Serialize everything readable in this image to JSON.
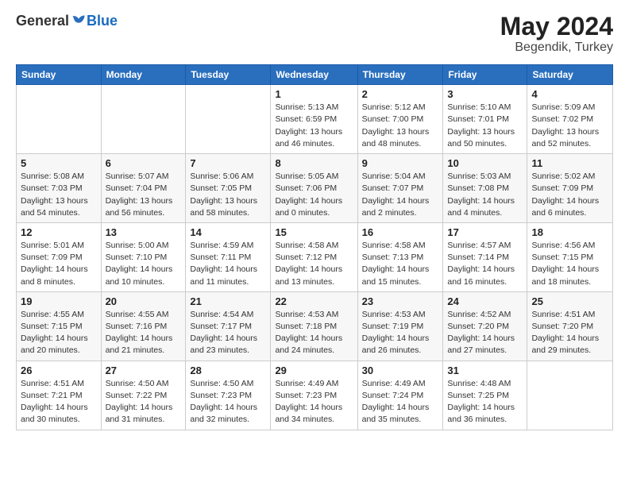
{
  "logo": {
    "general": "General",
    "blue": "Blue"
  },
  "header": {
    "month": "May 2024",
    "location": "Begendik, Turkey"
  },
  "weekdays": [
    "Sunday",
    "Monday",
    "Tuesday",
    "Wednesday",
    "Thursday",
    "Friday",
    "Saturday"
  ],
  "weeks": [
    [
      {
        "day": "",
        "info": ""
      },
      {
        "day": "",
        "info": ""
      },
      {
        "day": "",
        "info": ""
      },
      {
        "day": "1",
        "info": "Sunrise: 5:13 AM\nSunset: 6:59 PM\nDaylight: 13 hours\nand 46 minutes."
      },
      {
        "day": "2",
        "info": "Sunrise: 5:12 AM\nSunset: 7:00 PM\nDaylight: 13 hours\nand 48 minutes."
      },
      {
        "day": "3",
        "info": "Sunrise: 5:10 AM\nSunset: 7:01 PM\nDaylight: 13 hours\nand 50 minutes."
      },
      {
        "day": "4",
        "info": "Sunrise: 5:09 AM\nSunset: 7:02 PM\nDaylight: 13 hours\nand 52 minutes."
      }
    ],
    [
      {
        "day": "5",
        "info": "Sunrise: 5:08 AM\nSunset: 7:03 PM\nDaylight: 13 hours\nand 54 minutes."
      },
      {
        "day": "6",
        "info": "Sunrise: 5:07 AM\nSunset: 7:04 PM\nDaylight: 13 hours\nand 56 minutes."
      },
      {
        "day": "7",
        "info": "Sunrise: 5:06 AM\nSunset: 7:05 PM\nDaylight: 13 hours\nand 58 minutes."
      },
      {
        "day": "8",
        "info": "Sunrise: 5:05 AM\nSunset: 7:06 PM\nDaylight: 14 hours\nand 0 minutes."
      },
      {
        "day": "9",
        "info": "Sunrise: 5:04 AM\nSunset: 7:07 PM\nDaylight: 14 hours\nand 2 minutes."
      },
      {
        "day": "10",
        "info": "Sunrise: 5:03 AM\nSunset: 7:08 PM\nDaylight: 14 hours\nand 4 minutes."
      },
      {
        "day": "11",
        "info": "Sunrise: 5:02 AM\nSunset: 7:09 PM\nDaylight: 14 hours\nand 6 minutes."
      }
    ],
    [
      {
        "day": "12",
        "info": "Sunrise: 5:01 AM\nSunset: 7:09 PM\nDaylight: 14 hours\nand 8 minutes."
      },
      {
        "day": "13",
        "info": "Sunrise: 5:00 AM\nSunset: 7:10 PM\nDaylight: 14 hours\nand 10 minutes."
      },
      {
        "day": "14",
        "info": "Sunrise: 4:59 AM\nSunset: 7:11 PM\nDaylight: 14 hours\nand 11 minutes."
      },
      {
        "day": "15",
        "info": "Sunrise: 4:58 AM\nSunset: 7:12 PM\nDaylight: 14 hours\nand 13 minutes."
      },
      {
        "day": "16",
        "info": "Sunrise: 4:58 AM\nSunset: 7:13 PM\nDaylight: 14 hours\nand 15 minutes."
      },
      {
        "day": "17",
        "info": "Sunrise: 4:57 AM\nSunset: 7:14 PM\nDaylight: 14 hours\nand 16 minutes."
      },
      {
        "day": "18",
        "info": "Sunrise: 4:56 AM\nSunset: 7:15 PM\nDaylight: 14 hours\nand 18 minutes."
      }
    ],
    [
      {
        "day": "19",
        "info": "Sunrise: 4:55 AM\nSunset: 7:15 PM\nDaylight: 14 hours\nand 20 minutes."
      },
      {
        "day": "20",
        "info": "Sunrise: 4:55 AM\nSunset: 7:16 PM\nDaylight: 14 hours\nand 21 minutes."
      },
      {
        "day": "21",
        "info": "Sunrise: 4:54 AM\nSunset: 7:17 PM\nDaylight: 14 hours\nand 23 minutes."
      },
      {
        "day": "22",
        "info": "Sunrise: 4:53 AM\nSunset: 7:18 PM\nDaylight: 14 hours\nand 24 minutes."
      },
      {
        "day": "23",
        "info": "Sunrise: 4:53 AM\nSunset: 7:19 PM\nDaylight: 14 hours\nand 26 minutes."
      },
      {
        "day": "24",
        "info": "Sunrise: 4:52 AM\nSunset: 7:20 PM\nDaylight: 14 hours\nand 27 minutes."
      },
      {
        "day": "25",
        "info": "Sunrise: 4:51 AM\nSunset: 7:20 PM\nDaylight: 14 hours\nand 29 minutes."
      }
    ],
    [
      {
        "day": "26",
        "info": "Sunrise: 4:51 AM\nSunset: 7:21 PM\nDaylight: 14 hours\nand 30 minutes."
      },
      {
        "day": "27",
        "info": "Sunrise: 4:50 AM\nSunset: 7:22 PM\nDaylight: 14 hours\nand 31 minutes."
      },
      {
        "day": "28",
        "info": "Sunrise: 4:50 AM\nSunset: 7:23 PM\nDaylight: 14 hours\nand 32 minutes."
      },
      {
        "day": "29",
        "info": "Sunrise: 4:49 AM\nSunset: 7:23 PM\nDaylight: 14 hours\nand 34 minutes."
      },
      {
        "day": "30",
        "info": "Sunrise: 4:49 AM\nSunset: 7:24 PM\nDaylight: 14 hours\nand 35 minutes."
      },
      {
        "day": "31",
        "info": "Sunrise: 4:48 AM\nSunset: 7:25 PM\nDaylight: 14 hours\nand 36 minutes."
      },
      {
        "day": "",
        "info": ""
      }
    ]
  ]
}
